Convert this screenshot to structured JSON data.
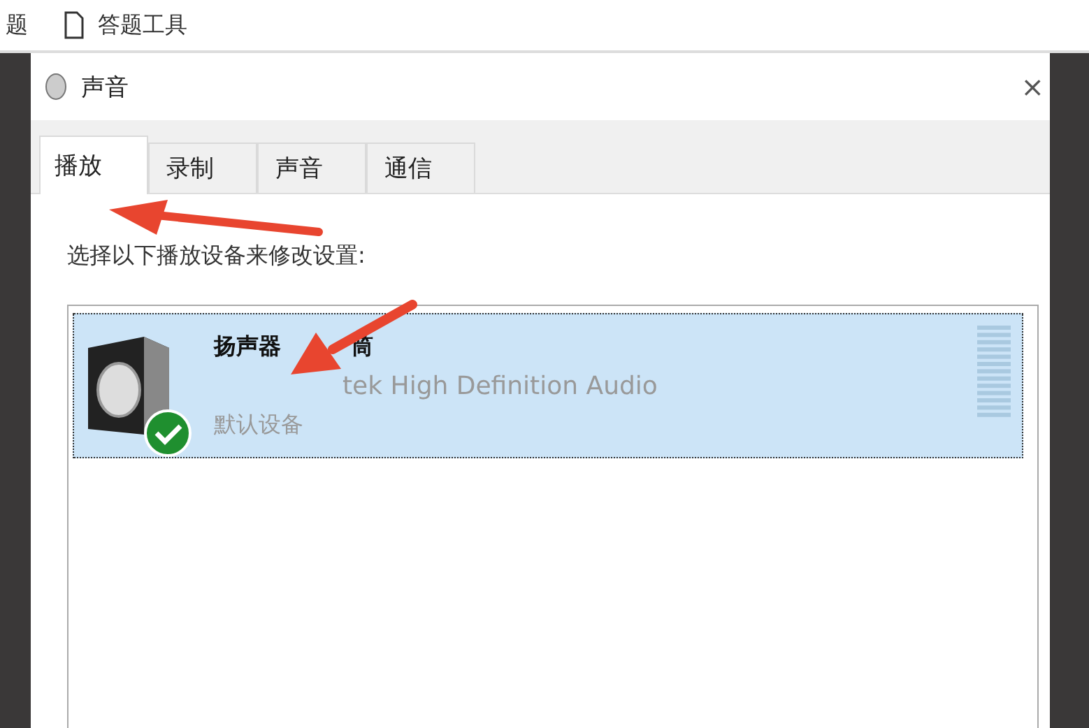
{
  "top_bar": {
    "items": [
      {
        "label": "题",
        "kind": "text"
      },
      {
        "label": "答题工具",
        "kind": "document"
      }
    ]
  },
  "window": {
    "title": "声音",
    "close": "×"
  },
  "tabs": [
    {
      "label": "播放",
      "selected": true
    },
    {
      "label": "录制",
      "selected": false
    },
    {
      "label": "声音",
      "selected": false
    },
    {
      "label": "通信",
      "selected": false
    }
  ],
  "instruction": "选择以下播放设备来修改设置:",
  "devices": [
    {
      "name": "扬声器",
      "name_tail": "筒",
      "detail": "tek High Definition Audio",
      "status": "默认设备",
      "selected": true,
      "default": true
    }
  ]
}
